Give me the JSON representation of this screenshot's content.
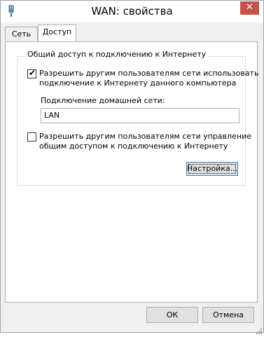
{
  "window": {
    "title": "WAN: свойства",
    "close_glyph": "✕"
  },
  "tabs": [
    {
      "label": "Сеть"
    },
    {
      "label": "Доступ"
    }
  ],
  "sharing": {
    "group_title": "Общий доступ к подключению к Интернету",
    "allow_others": {
      "checked": true,
      "line1": "Разрешить другим пользователям сети использовать",
      "line2": "подключение к Интернету данного компьютера"
    },
    "home_network_label": "Подключение домашней сети:",
    "home_network_value": "LAN",
    "allow_control": {
      "checked": false,
      "line1": "Разрешить другим пользователям сети управление",
      "line2": "общим доступом к подключению к Интернету"
    },
    "settings_button": "Настройка..."
  },
  "footer": {
    "ok": "ОК",
    "cancel": "Отмена"
  },
  "icons": {
    "app": "network-plug-icon",
    "check": "checkmark-icon",
    "close": "close-icon",
    "grip": "resize-grip-icon"
  }
}
